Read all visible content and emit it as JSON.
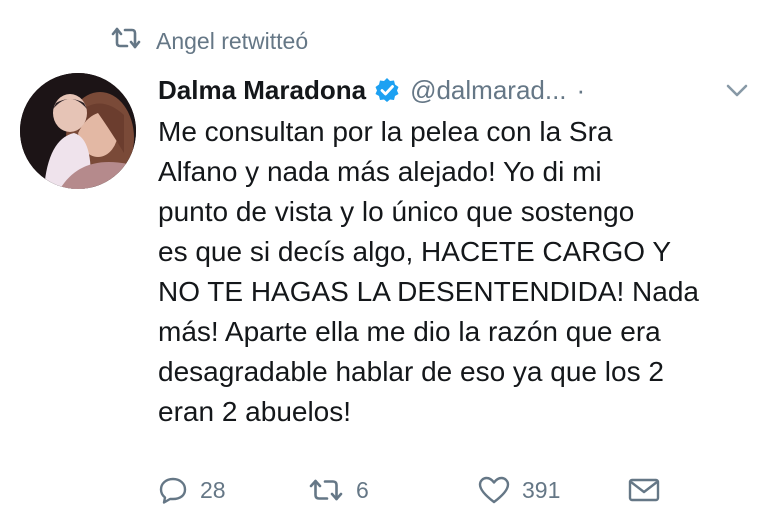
{
  "retweet_context": {
    "icon": "retweet-icon",
    "text": "Angel retwitteó"
  },
  "tweet": {
    "author_name": "Dalma Maradona",
    "verified_icon": "verified-badge-icon",
    "handle": "@dalmarad...",
    "separator": "·",
    "menu_icon": "chevron-down-icon",
    "avatar": "user-avatar",
    "text": "Me consultan por la pelea con la Sra\nAlfano y nada más alejado! Yo di mi\npunto de vista y lo único que sostengo\nes que si decís algo, HACETE CARGO Y\nNO TE HAGAS LA DESENTENDIDA! Nada\nmás! Aparte ella me dio la razón que era\ndesagradable hablar de eso ya que los 2\neran 2 abuelos!"
  },
  "actions": {
    "reply_count": "28",
    "retweet_count": "6",
    "like_count": "391"
  },
  "colors": {
    "verified_blue": "#1da1f2",
    "secondary_text": "#657786",
    "primary_text": "#14171a"
  }
}
